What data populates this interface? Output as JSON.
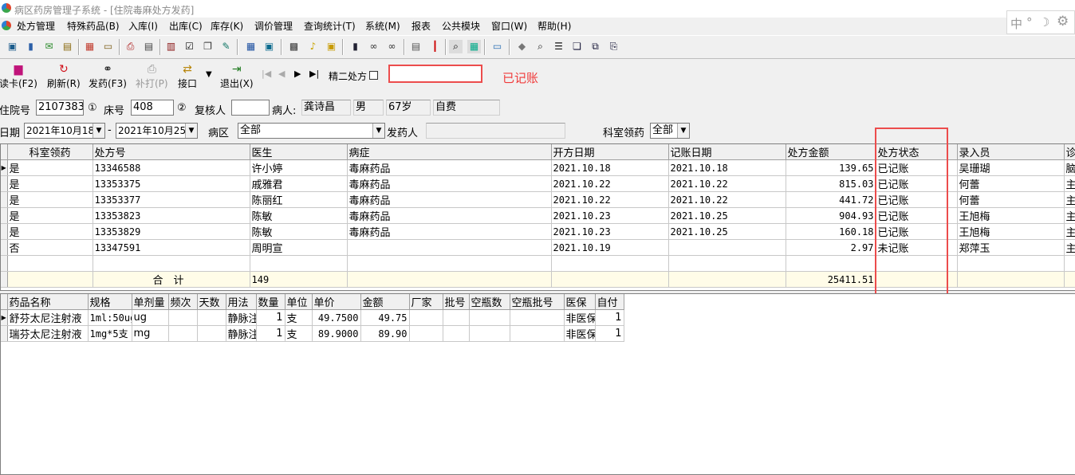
{
  "window": {
    "title": "病区药房管理子系统 - [住院毒麻处方发药]"
  },
  "menu": [
    "处方管理",
    "特殊药品(B)",
    "入库(I)",
    "出库(C)",
    "库存(K)",
    "调价管理",
    "查询统计(T)",
    "系统(M)",
    "报表",
    "公共模块",
    "窗口(W)",
    "帮助(H)"
  ],
  "ime": {
    "lang": "中",
    "symbol": "°",
    "moon": "☽",
    "gear": "⚙"
  },
  "toolbar2": {
    "read_card": "读卡(F2)",
    "refresh": "刷新(R)",
    "dispense": "发药(F3)",
    "reprint": "补打(P)",
    "interface": "接口",
    "exit": "退出(X)",
    "first": "|◀",
    "prev": "◀",
    "next": "▶",
    "last": "▶|",
    "jing2_label": "精二处方",
    "posted_label": "已记账"
  },
  "patient": {
    "inpatient_no_label": "住院号",
    "inpatient_no": "2107383",
    "marker1": "①",
    "bed_label": "床号",
    "bed_no": "408",
    "marker2": "②",
    "reviewer_label": "复核人",
    "reviewer": "",
    "patient_label": "病人:",
    "name": "龚诗昌",
    "sex": "男",
    "age": "67岁",
    "pay_type": "自费"
  },
  "filter": {
    "date_label": "日期",
    "date_from": "2021年10月18",
    "date_sep": "-",
    "date_to": "2021年10月25",
    "ward_label": "病区",
    "ward_value": "全部",
    "dispenser_label": "发药人",
    "dispenser": "",
    "dept_collect_label": "科室领药",
    "dept_collect_value": "全部"
  },
  "rx_table": {
    "columns": [
      "科室领药",
      "处方号",
      "医生",
      "病症",
      "开方日期",
      "记账日期",
      "处方金额",
      "处方状态",
      "录入员",
      "诊"
    ],
    "rows": [
      [
        "是",
        "13346588",
        "许小婷",
        "毒麻药品",
        "2021.10.18",
        "2021.10.18",
        "139.65",
        "已记账",
        "吴珊瑚",
        "脑"
      ],
      [
        "是",
        "13353375",
        "戚雅君",
        "毒麻药品",
        "2021.10.22",
        "2021.10.22",
        "815.03",
        "已记账",
        "何蕾",
        "主"
      ],
      [
        "是",
        "13353377",
        "陈丽红",
        "毒麻药品",
        "2021.10.22",
        "2021.10.22",
        "441.72",
        "已记账",
        "何蕾",
        "主"
      ],
      [
        "是",
        "13353823",
        "陈敏",
        "毒麻药品",
        "2021.10.23",
        "2021.10.25",
        "904.93",
        "已记账",
        "王旭梅",
        "主"
      ],
      [
        "是",
        "13353829",
        "陈敏",
        "毒麻药品",
        "2021.10.23",
        "2021.10.25",
        "160.18",
        "已记账",
        "王旭梅",
        "主"
      ],
      [
        "否",
        "13347591",
        "周明宣",
        "",
        "2021.10.19",
        "",
        "2.97",
        "未记账",
        "郑萍玉",
        "主"
      ]
    ],
    "total_label": "合　计",
    "total_count": "149",
    "total_amount": "25411.51"
  },
  "drug_table": {
    "columns": [
      "药品名称",
      "规格",
      "单剂量",
      "频次",
      "天数",
      "用法",
      "数量",
      "单位",
      "单价",
      "金额",
      "厂家",
      "批号",
      "空瓶数",
      "空瓶批号",
      "医保",
      "自付"
    ],
    "rows": [
      [
        "舒芬太尼注射液",
        "1ml:50ug",
        "ug",
        "",
        "",
        "静脉注射",
        "1",
        "支",
        "49.7500",
        "49.75",
        "",
        "",
        "",
        "",
        "非医保",
        "1"
      ],
      [
        "瑞芬太尼注射液",
        "1mg*5支",
        "mg",
        "",
        "",
        "静脉注射",
        "1",
        "支",
        "89.9000",
        "89.90",
        "",
        "",
        "",
        "",
        "非医保",
        "1"
      ]
    ]
  }
}
